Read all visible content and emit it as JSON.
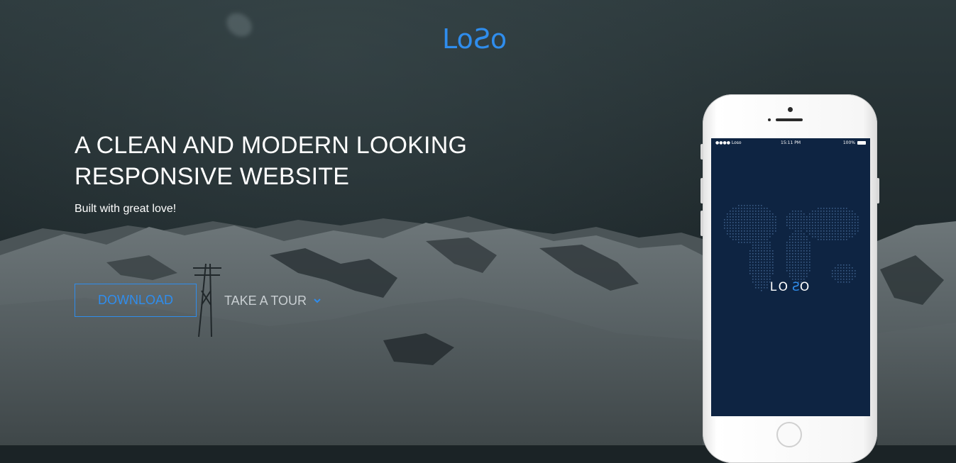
{
  "brand": {
    "logo_prefix": "Lo",
    "logo_mark": "S",
    "logo_suffix": "o",
    "accent_color": "#2f8ded"
  },
  "hero": {
    "title_line1": "A CLEAN AND MODERN LOOKING",
    "title_line2": "RESPONSIVE WEBSITE",
    "subtitle": "Built with great love!",
    "download_label": "DOWNLOAD",
    "tour_label": "TAKE A TOUR",
    "tour_icon": "chevron-down-icon"
  },
  "phone": {
    "status_left": "●●●● Loso",
    "status_time": "15:11 PM",
    "status_battery": "100%",
    "app_logo_prefix": "LO",
    "app_logo_mark": "S",
    "app_logo_suffix": "O",
    "screen_color": "#0e2442"
  }
}
